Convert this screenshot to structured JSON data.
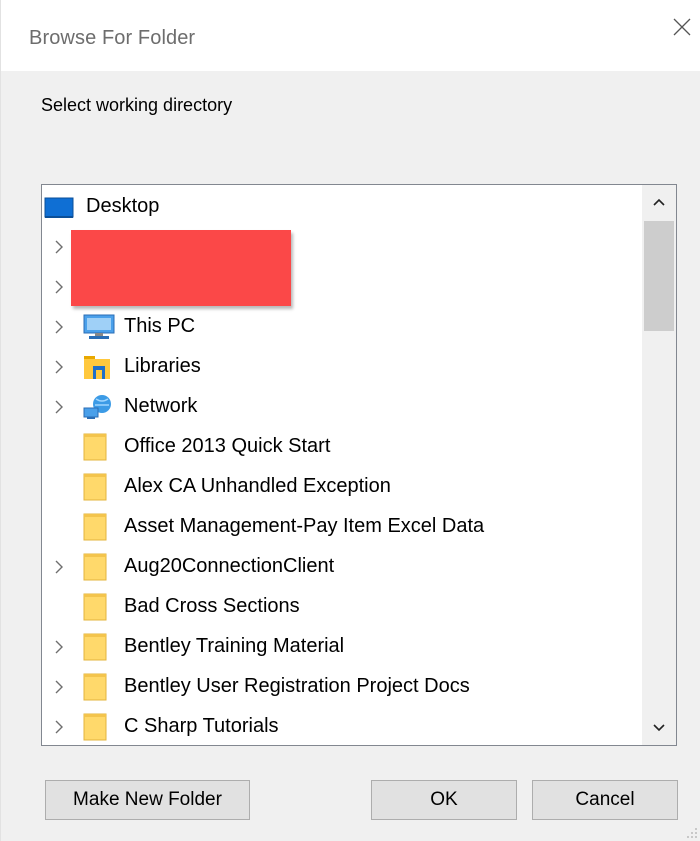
{
  "window": {
    "title": "Browse For Folder",
    "prompt": "Select working directory"
  },
  "tree": {
    "items": [
      {
        "label": "Desktop",
        "icon": "desktop-icon",
        "expandable": false,
        "level": 0
      },
      {
        "label": "",
        "icon": "redacted",
        "expandable": true,
        "level": 1
      },
      {
        "label": "",
        "icon": "redacted",
        "expandable": true,
        "level": 1
      },
      {
        "label": "This PC",
        "icon": "computer-icon",
        "expandable": true,
        "level": 1
      },
      {
        "label": "Libraries",
        "icon": "libraries-icon",
        "expandable": true,
        "level": 1
      },
      {
        "label": "Network",
        "icon": "network-icon",
        "expandable": true,
        "level": 1
      },
      {
        "label": "Office 2013 Quick Start",
        "icon": "folder-icon",
        "expandable": false,
        "level": 1
      },
      {
        "label": "Alex CA Unhandled Exception",
        "icon": "folder-icon",
        "expandable": false,
        "level": 1
      },
      {
        "label": "Asset Management-Pay Item Excel Data",
        "icon": "folder-icon",
        "expandable": false,
        "level": 1
      },
      {
        "label": "Aug20ConnectionClient",
        "icon": "folder-icon",
        "expandable": true,
        "level": 1
      },
      {
        "label": "Bad Cross Sections",
        "icon": "folder-icon",
        "expandable": false,
        "level": 1
      },
      {
        "label": "Bentley Training Material",
        "icon": "folder-icon",
        "expandable": true,
        "level": 1
      },
      {
        "label": "Bentley User Registration Project Docs",
        "icon": "folder-icon",
        "expandable": true,
        "level": 1
      },
      {
        "label": "C Sharp Tutorials",
        "icon": "folder-icon",
        "expandable": true,
        "level": 1
      }
    ]
  },
  "buttons": {
    "new_folder": "Make New Folder",
    "ok": "OK",
    "cancel": "Cancel"
  },
  "colors": {
    "folder": "#ffd96b",
    "selection_redaction": "#fb4848",
    "desktop": "#0f6fd4"
  }
}
